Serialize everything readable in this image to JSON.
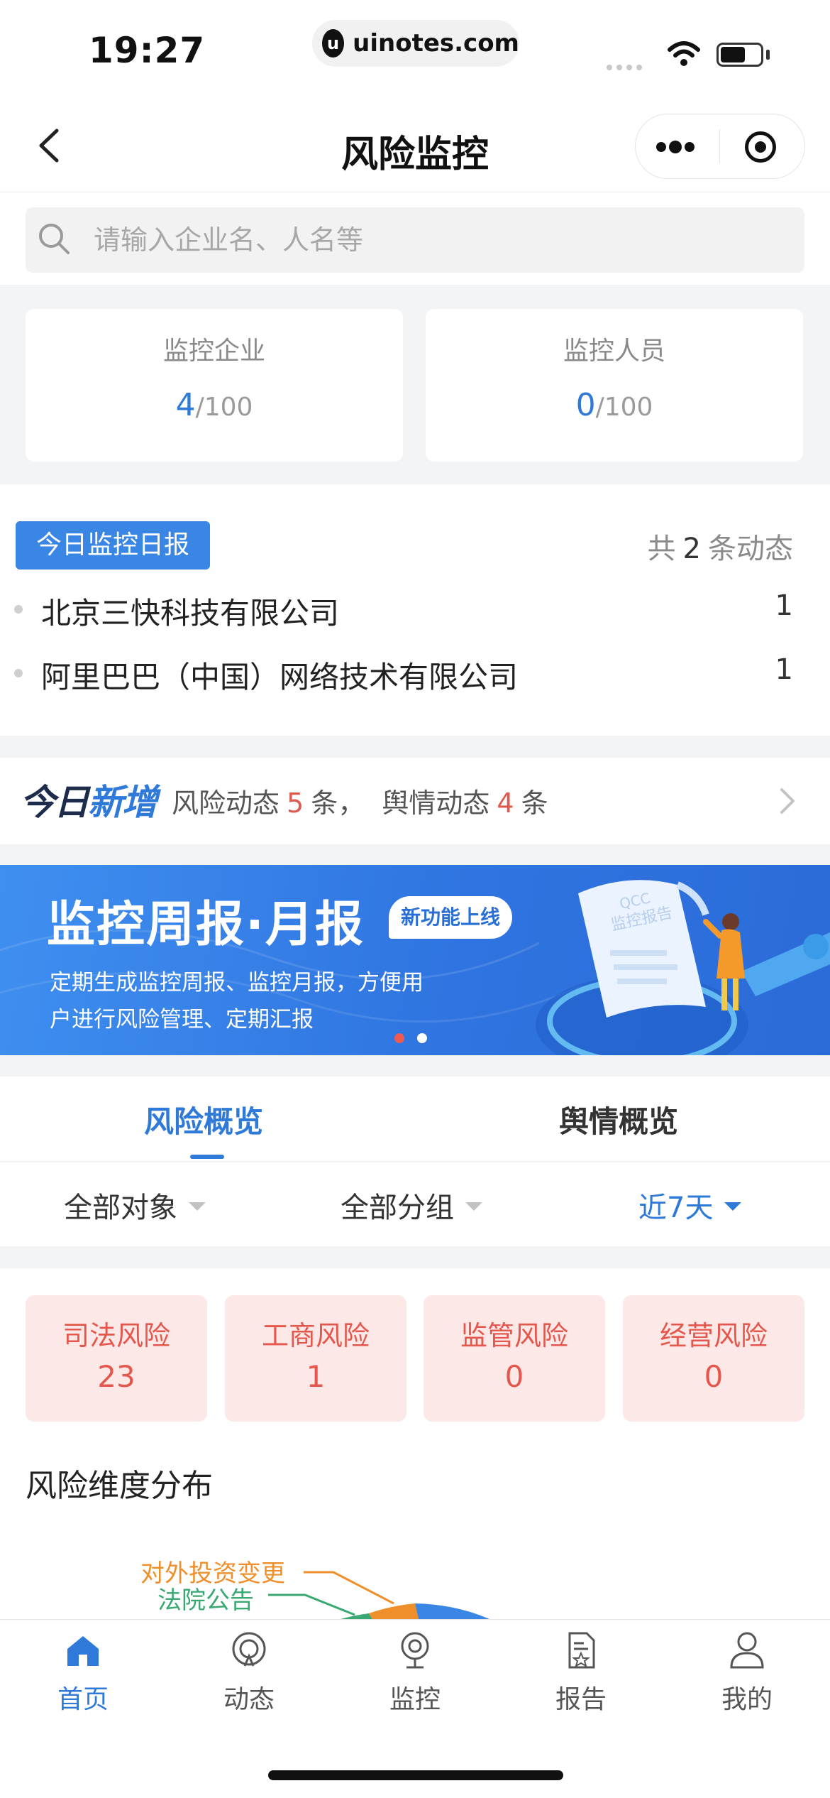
{
  "status_bar": {
    "time": "19:27",
    "url": "uinotes.com",
    "url_logo": "u"
  },
  "nav": {
    "title": "风险监控"
  },
  "search": {
    "placeholder": "请输入企业名、人名等"
  },
  "stats": [
    {
      "label": "监控企业",
      "current": "4",
      "total": "/100"
    },
    {
      "label": "监控人员",
      "current": "0",
      "total": "/100"
    }
  ],
  "daily": {
    "tag": "今日监控日报",
    "count_prefix": "共",
    "count": "2",
    "count_suffix": "条动态",
    "items": [
      {
        "name": "北京三快科技有限公司",
        "count": "1"
      },
      {
        "name": "阿里巴巴（中国）网络技术有限公司",
        "count": "1"
      }
    ]
  },
  "today": {
    "logo_a": "今日",
    "logo_b": "新增",
    "risk_label": "风险动态",
    "risk_count": "5",
    "unit1": "条，",
    "opinion_label": "舆情动态",
    "opinion_count": "4",
    "unit2": "条"
  },
  "banner": {
    "title": "监控周报·月报",
    "badge": "新功能上线",
    "line1": "定期生成监控周报、监控月报，方便用",
    "line2": "户进行风险管理、定期汇报",
    "art_text1": "QCC",
    "art_text2": "监控报告"
  },
  "tabs": [
    {
      "label": "风险概览",
      "active": true
    },
    {
      "label": "舆情概览",
      "active": false
    }
  ],
  "filters": [
    {
      "label": "全部对象"
    },
    {
      "label": "全部分组"
    },
    {
      "label": "近7天"
    }
  ],
  "risk_cards": [
    {
      "label": "司法风险",
      "value": "23"
    },
    {
      "label": "工商风险",
      "value": "1"
    },
    {
      "label": "监管风险",
      "value": "0"
    },
    {
      "label": "经营风险",
      "value": "0"
    }
  ],
  "distribution": {
    "title": "风险维度分布",
    "labels": [
      {
        "text": "对外投资变更",
        "color": "#ef8f2c"
      },
      {
        "text": "法院公告",
        "color": "#3aa873"
      }
    ]
  },
  "bottom_nav": [
    {
      "label": "首页",
      "icon": "home-icon",
      "active": true
    },
    {
      "label": "动态",
      "icon": "signal-icon",
      "active": false
    },
    {
      "label": "监控",
      "icon": "webcam-icon",
      "active": false
    },
    {
      "label": "报告",
      "icon": "report-icon",
      "active": false
    },
    {
      "label": "我的",
      "icon": "user-icon",
      "active": false
    }
  ],
  "colors": {
    "accent": "#2f7ad9",
    "risk": "#e5574c",
    "risk_bg": "#fce8e7"
  }
}
